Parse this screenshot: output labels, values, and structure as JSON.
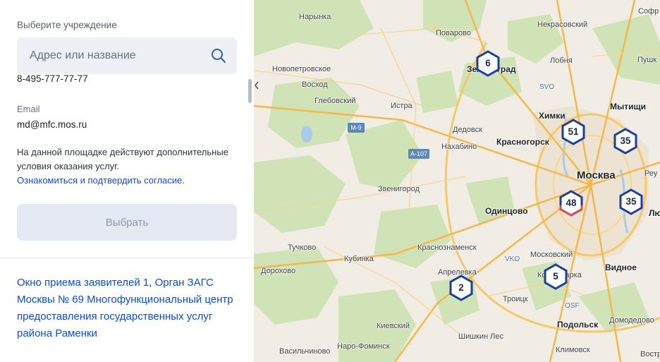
{
  "panel": {
    "title": "Выберите учреждение",
    "search_placeholder": "Адрес или название",
    "phone": "8-495-777-77-77",
    "email_label": "Email",
    "email_value": "md@mfc.mos.ru",
    "notice_text": "На данной площадке действуют дополнительные условия оказания услуг.",
    "notice_link": "Ознакомиться и подтвердить согласие.",
    "select_button": "Выбрать",
    "result_title": "Окно приема заявителей 1, Орган ЗАГС Москвы № 69 Многофункциональный центр предоставления государственных услуг района Раменки"
  },
  "map": {
    "labels": {
      "narynka": "Нарынка",
      "povarovo": "Поварово",
      "nekrasovsky": "Некрасовский",
      "sofr": "Софр",
      "novopetrovskoe": "Новопетровское",
      "zelenograd": "Зеленоград",
      "lobnya": "Лобня",
      "pushk": "Пушк",
      "voskhod": "Восход",
      "svo": "SVO",
      "glebovsky": "Глебовский",
      "istra": "Истра",
      "khimki": "Химки",
      "mytishchi": "Мытищи",
      "dedovsk": "Дедовск",
      "nakhabino": "Нахабино",
      "krasnogorsk": "Красногорск",
      "moskva": "Москва",
      "reu": "Реу",
      "zvenigorod": "Звенигород",
      "odintsovo": "Одинцово",
      "lyu": "Лю",
      "tuchkovo": "Тучково",
      "kubinka": "Кубинка",
      "krasnoznamensk": "Краснознаменск",
      "moskovsky": "Московский",
      "vko": "VKO",
      "dorokhovo": "Дорохово",
      "aprelevka": "Апрелевка",
      "kommunarka": "Коммунарка",
      "vidnoe": "Видное",
      "troitsk": "Троицк",
      "osf": "OSF",
      "kievsky": "Киевский",
      "podolsk": "Подольск",
      "domodedovo": "Домодедово",
      "shishkin_les": "Шишкин Лес",
      "naro_fominsk": "Наро-Фоминск",
      "klimovsk": "Климовск",
      "vasilchinovo": "Васильчиново",
      "vostr": "Востр"
    },
    "road_shields": {
      "m9": "М-9",
      "a107": "А-107"
    },
    "clusters": [
      {
        "id": "zelenograd",
        "count": "6",
        "color": "#1a3f9e"
      },
      {
        "id": "khimki",
        "count": "51",
        "color": "#1a3f9e"
      },
      {
        "id": "mytishchi",
        "count": "35",
        "color": "#1a3f9e"
      },
      {
        "id": "center",
        "count": "48",
        "color": "#1a3f9e",
        "selected_color": "#e04a55"
      },
      {
        "id": "east",
        "count": "35",
        "color": "#1a3f9e"
      },
      {
        "id": "aprelevka",
        "count": "2",
        "color": "#1a3f9e"
      },
      {
        "id": "kommunarka",
        "count": "5",
        "color": "#1a3f9e"
      }
    ]
  }
}
